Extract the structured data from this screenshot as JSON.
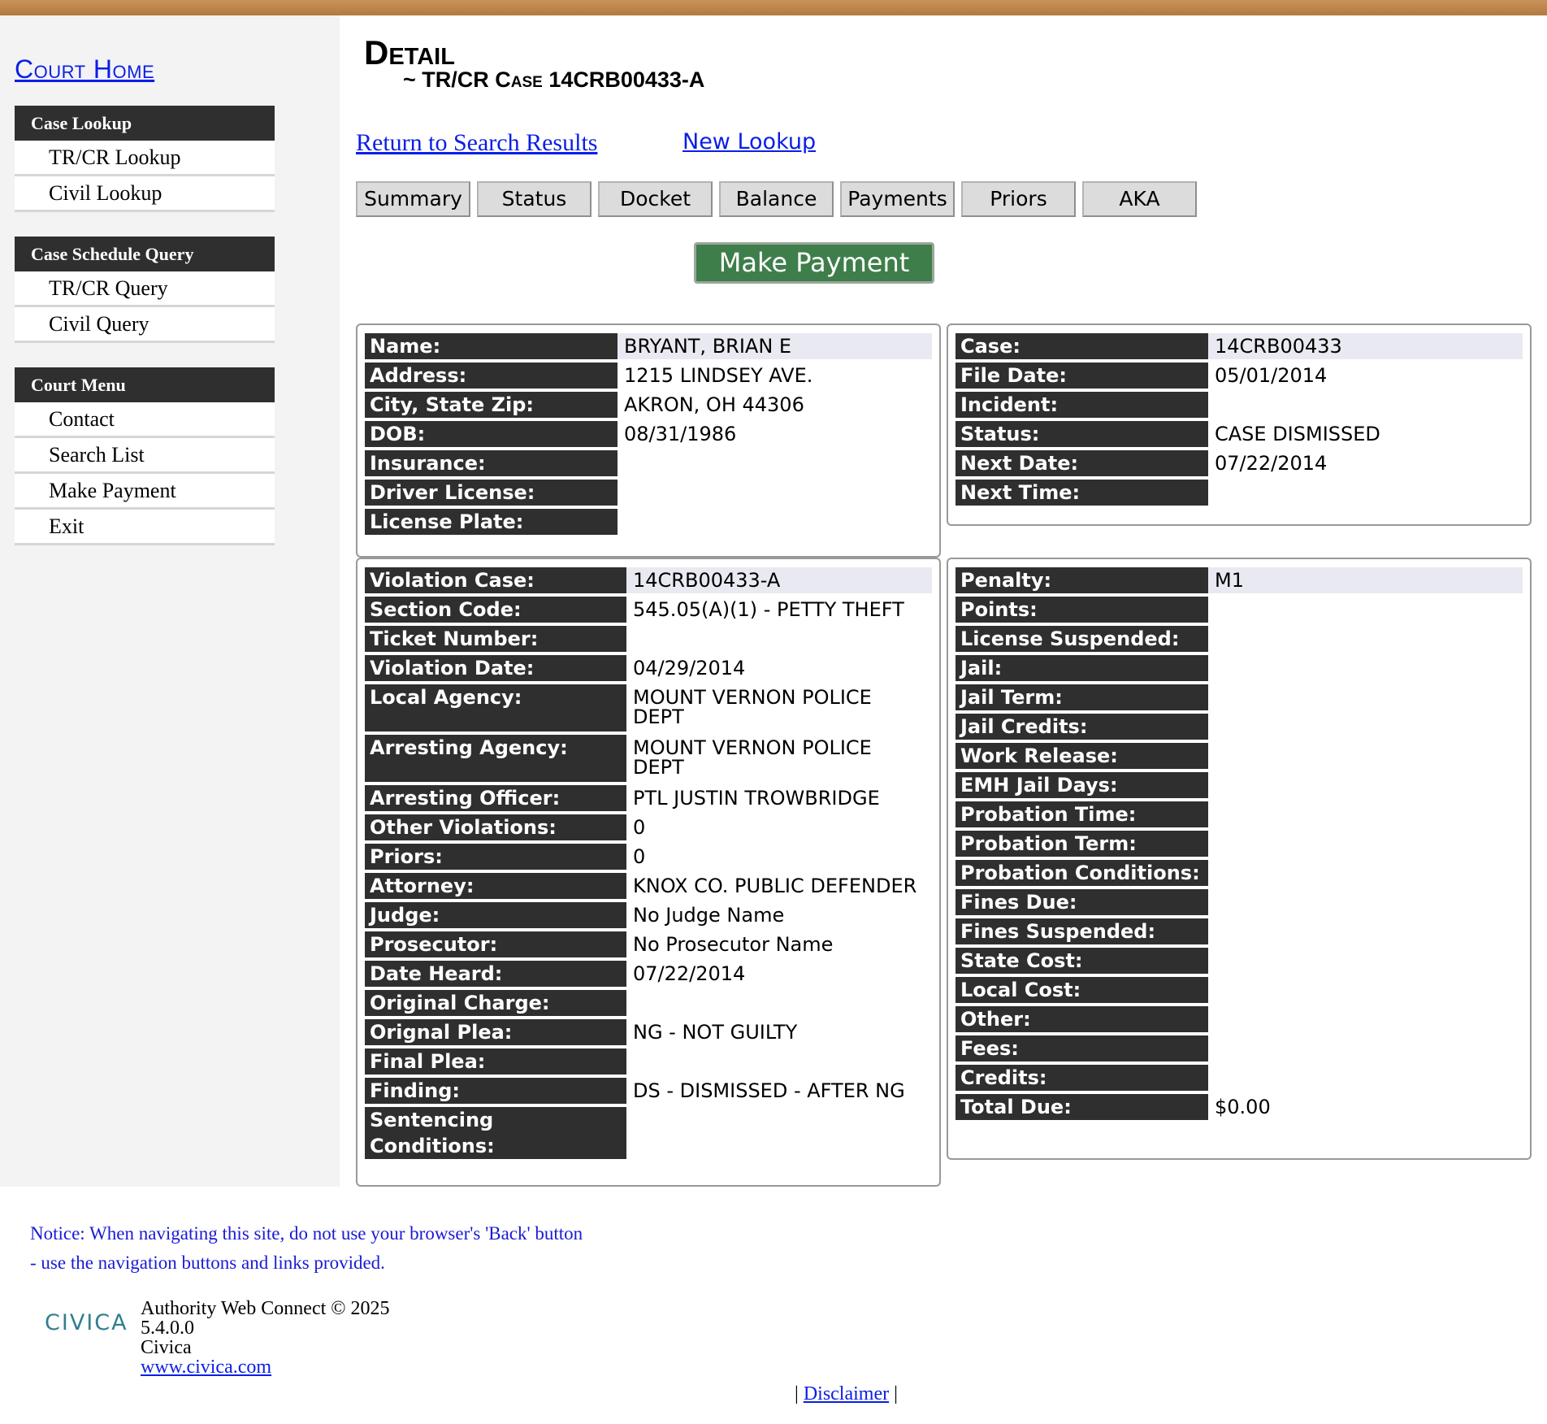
{
  "sidebar": {
    "court_home": "Court Home",
    "groups": [
      {
        "header": "Case Lookup",
        "items": [
          "TR/CR Lookup",
          "Civil Lookup"
        ]
      },
      {
        "header": "Case Schedule Query",
        "items": [
          "TR/CR Query",
          "Civil Query"
        ]
      },
      {
        "header": "Court Menu",
        "items": [
          "Contact",
          "Search List",
          "Make Payment",
          "Exit"
        ]
      }
    ]
  },
  "header": {
    "title": "Detail",
    "subtitle": "~ TR/CR Case 14CRB00433-A"
  },
  "links": {
    "return": "Return to Search Results",
    "new_lookup": "New Lookup"
  },
  "tabs": [
    "Summary",
    "Status",
    "Docket",
    "Balance",
    "Payments",
    "Priors",
    "AKA"
  ],
  "make_payment": "Make Payment",
  "person": [
    {
      "label": "Name:",
      "value": "BRYANT, BRIAN E"
    },
    {
      "label": "Address:",
      "value": "1215 LINDSEY AVE."
    },
    {
      "label": "City, State Zip:",
      "value": "AKRON, OH 44306"
    },
    {
      "label": "DOB:",
      "value": "08/31/1986"
    },
    {
      "label": "Insurance:",
      "value": ""
    },
    {
      "label": "Driver License:",
      "value": ""
    },
    {
      "label": "License Plate:",
      "value": ""
    }
  ],
  "case": [
    {
      "label": "Case:",
      "value": "14CRB00433"
    },
    {
      "label": "File Date:",
      "value": "05/01/2014"
    },
    {
      "label": "Incident:",
      "value": ""
    },
    {
      "label": "Status:",
      "value": "CASE DISMISSED"
    },
    {
      "label": "Next Date:",
      "value": "07/22/2014"
    },
    {
      "label": "Next Time:",
      "value": ""
    }
  ],
  "violation": [
    {
      "label": "Violation Case:",
      "value": "14CRB00433-A"
    },
    {
      "label": "Section Code:",
      "value": "545.05(A)(1) - PETTY THEFT"
    },
    {
      "label": "Ticket Number:",
      "value": ""
    },
    {
      "label": "Violation Date:",
      "value": "04/29/2014"
    },
    {
      "label": "Local Agency:",
      "value": "MOUNT VERNON POLICE DEPT",
      "tall": true
    },
    {
      "label": "Arresting Agency:",
      "value": "MOUNT VERNON POLICE DEPT",
      "tall": true
    },
    {
      "label": "Arresting Officer:",
      "value": "PTL JUSTIN TROWBRIDGE"
    },
    {
      "label": "Other Violations:",
      "value": "0"
    },
    {
      "label": "Priors:",
      "value": "0"
    },
    {
      "label": "Attorney:",
      "value": "KNOX CO. PUBLIC DEFENDER"
    },
    {
      "label": "Judge:",
      "value": "No Judge Name"
    },
    {
      "label": "Prosecutor:",
      "value": "No Prosecutor Name"
    },
    {
      "label": "Date Heard:",
      "value": "07/22/2014"
    },
    {
      "label": "Original Charge:",
      "value": ""
    },
    {
      "label": "Orignal Plea:",
      "value": "NG - NOT GUILTY"
    },
    {
      "label": "Final Plea:",
      "value": ""
    },
    {
      "label": "Finding:",
      "value": "DS - DISMISSED - AFTER NG"
    },
    {
      "label": "Sentencing Conditions:",
      "value": ""
    }
  ],
  "penalty": [
    {
      "label": "Penalty:",
      "value": "M1"
    },
    {
      "label": "Points:",
      "value": ""
    },
    {
      "label": "License Suspended:",
      "value": ""
    },
    {
      "label": "Jail:",
      "value": ""
    },
    {
      "label": "Jail Term:",
      "value": ""
    },
    {
      "label": "Jail Credits:",
      "value": ""
    },
    {
      "label": "Work Release:",
      "value": ""
    },
    {
      "label": "EMH Jail Days:",
      "value": ""
    },
    {
      "label": "Probation Time:",
      "value": ""
    },
    {
      "label": "Probation Term:",
      "value": ""
    },
    {
      "label": "Probation Conditions:",
      "value": ""
    },
    {
      "label": "Fines Due:",
      "value": ""
    },
    {
      "label": "Fines Suspended:",
      "value": ""
    },
    {
      "label": "State Cost:",
      "value": ""
    },
    {
      "label": "Local Cost:",
      "value": ""
    },
    {
      "label": "Other:",
      "value": ""
    },
    {
      "label": "Fees:",
      "value": ""
    },
    {
      "label": "Credits:",
      "value": ""
    },
    {
      "label": "Total Due:",
      "value": "$0.00"
    }
  ],
  "footer": {
    "notice_line1": "Notice: When navigating this site, do not use your browser's 'Back' button",
    "notice_line2": "- use the navigation buttons and links provided.",
    "logo": "CIVICA",
    "product": "Authority Web Connect © 2025",
    "version": "5.4.0.0",
    "company": "Civica",
    "website": "www.civica.com",
    "disclaimer": "Disclaimer",
    "separator": "|"
  }
}
